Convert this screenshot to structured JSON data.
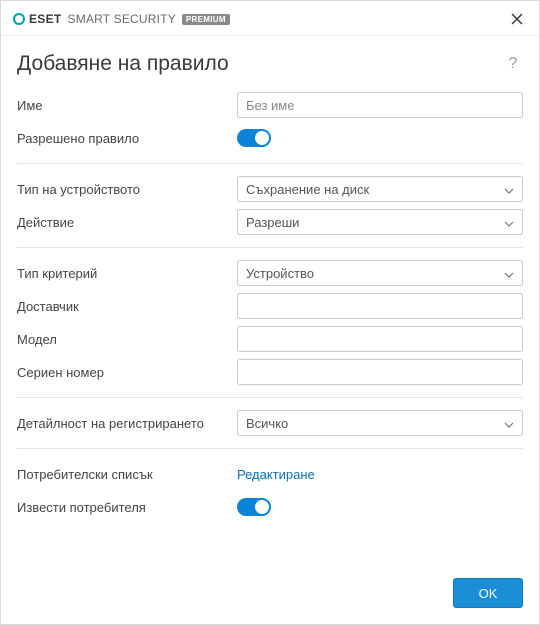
{
  "titlebar": {
    "brand_bold": "eset",
    "brand_light": "SMART SECURITY",
    "brand_badge": "PREMIUM"
  },
  "heading": "Добавяне на правило",
  "fields": {
    "name_label": "Име",
    "name_placeholder": "Без име",
    "enabled_label": "Разрешено правило",
    "device_type_label": "Тип на устройството",
    "device_type_value": "Съхранение на диск",
    "action_label": "Действие",
    "action_value": "Разреши",
    "criteria_type_label": "Тип критерий",
    "criteria_type_value": "Устройство",
    "vendor_label": "Доставчик",
    "vendor_value": "",
    "model_label": "Модел",
    "model_value": "",
    "serial_label": "Сериен номер",
    "serial_value": "",
    "logging_label": "Детайлност на регистрирането",
    "logging_value": "Всичко",
    "userlist_label": "Потребителски списък",
    "userlist_link": "Редактиране",
    "notify_label": "Извести потребителя"
  },
  "footer": {
    "ok": "OK"
  }
}
